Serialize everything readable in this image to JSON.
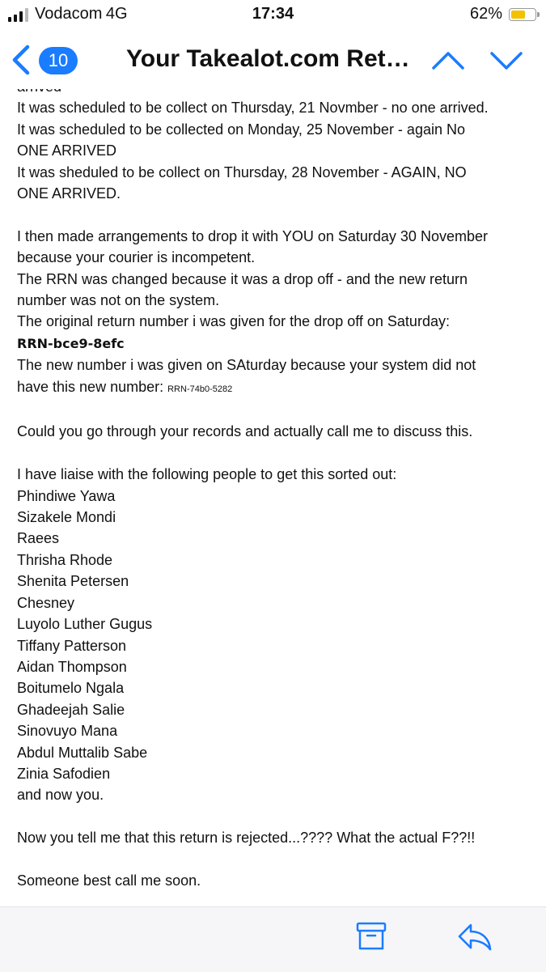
{
  "status_bar": {
    "carrier": "Vodacom",
    "network": "4G",
    "time": "17:34",
    "battery_percent": "62%",
    "battery_level": 0.62,
    "battery_color": "#f2c200"
  },
  "nav": {
    "unread_count": "10",
    "title": "Your Takealot.com Returns",
    "accent_color": "#1a7cff",
    "icons": [
      "back-chevron-icon",
      "chevron-up-icon",
      "chevron-down-icon"
    ]
  },
  "email": {
    "partial_top_line": "arrived",
    "paragraph1": [
      "It was scheduled to be collect on Thursday, 21 Novmber - no one arrived.",
      "It was scheduled to be collected on Monday, 25 November - again No",
      "ONE ARRIVED",
      "It was sheduled to be collect on Thursday, 28 November - AGAIN, NO",
      "ONE ARRIVED."
    ],
    "paragraph2": [
      "I then made arrangements to drop it with YOU on Saturday 30 November",
      "because your courier is incompetent.",
      "The RRN was changed because it was a drop off - and the new return",
      "number was not on the system.",
      "The original return number i was given for the drop off on Saturday:"
    ],
    "original_rrn": "RRN-bce9-8efc",
    "new_number_line1": "The new number i was given on SAturday because your system did not",
    "new_number_line2_prefix": "have this new number: ",
    "new_rrn": "RRN-74b0-5282",
    "paragraph3": "Could you go through your records and actually call me to discuss this.",
    "people_intro": "I have liaise with the following people to get this sorted out:",
    "people": [
      "Phindiwe Yawa",
      "Sizakele Mondi",
      "Raees",
      "Thrisha Rhode",
      "Shenita Petersen",
      "Chesney",
      "Luyolo Luther Gugus",
      "Tiffany Patterson",
      "Aidan Thompson",
      "Boitumelo Ngala",
      "Ghadeejah Salie",
      "Sinovuyo Mana",
      "Abdul Muttalib Sabe",
      "Zinia Safodien"
    ],
    "people_outro": "and now you.",
    "paragraph4": "Now you tell me that this return is rejected...???? What the actual F??!!",
    "closing": "Someone best call me soon."
  },
  "toolbar": {
    "icons": [
      "archive-icon",
      "reply-icon"
    ]
  }
}
